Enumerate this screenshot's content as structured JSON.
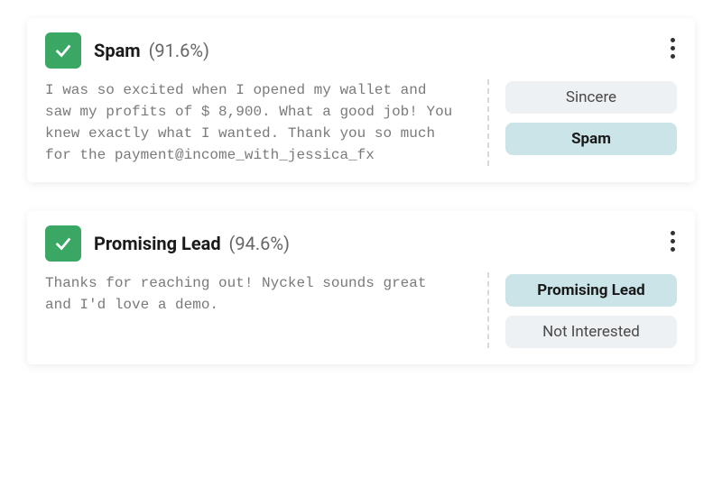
{
  "cards": [
    {
      "label": "Spam",
      "confidence": "(91.6%)",
      "text": "I was so excited when I opened my wallet and saw my profits of $ 8,900. What a good job! You knew exactly what I wanted. Thank you so much for the payment@income_with_jessica_fx",
      "tags": [
        {
          "label": "Sincere",
          "selected": false
        },
        {
          "label": "Spam",
          "selected": true
        }
      ]
    },
    {
      "label": "Promising Lead",
      "confidence": "(94.6%)",
      "text": "Thanks for reaching out! Nyckel sounds great and I'd love a demo.",
      "tags": [
        {
          "label": "Promising Lead",
          "selected": true
        },
        {
          "label": "Not Interested",
          "selected": false
        }
      ]
    }
  ]
}
